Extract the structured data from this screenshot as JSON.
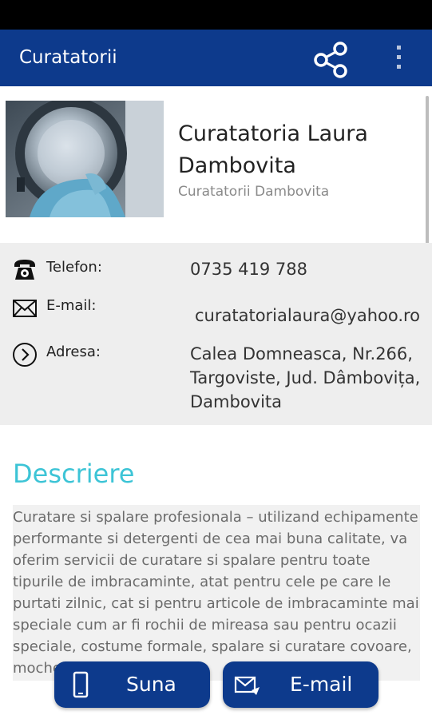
{
  "appbar": {
    "title": "Curatatorii",
    "share_icon": "share-icon",
    "overflow_icon": "overflow-menu-icon"
  },
  "business": {
    "name": "Curatatoria Laura Dambovita",
    "category": "Curatatorii Dambovita"
  },
  "info": {
    "phone": {
      "icon": "phone-icon",
      "label": "Telefon:",
      "value": "0735 419 788"
    },
    "email": {
      "icon": "mail-icon",
      "label": "E-mail:",
      "value": "curatatorialaura@yahoo.ro"
    },
    "address": {
      "icon": "chevron-right-circle-icon",
      "label": "Adresa:",
      "value": "Calea Domneasca, Nr.266, Targoviste, Jud. Dâmbovița, Dambovita"
    }
  },
  "description": {
    "title": "Descriere",
    "body": "Curatare si spalare profesionala – utilizand echipamente performante si detergenti de cea mai buna calitate, va oferim servicii de curatare si spalare pentru toate tipurile de imbracaminte, atat pentru cele pe care le purtati zilnic, cat si pentru articole de imbracaminte mai speciale cum ar fi rochii de mireasa sau pentru ocazii speciale, costume formale, spalare si curatare covoare, mochete"
  },
  "actions": {
    "call": {
      "label": "Suna",
      "icon": "phone-icon"
    },
    "email": {
      "label": "E-mail",
      "icon": "mail-send-icon"
    }
  },
  "colors": {
    "primary": "#0d3a8c",
    "accent": "#3dc4d6",
    "status_bar": "#000000",
    "info_bg": "#eeeeee"
  }
}
